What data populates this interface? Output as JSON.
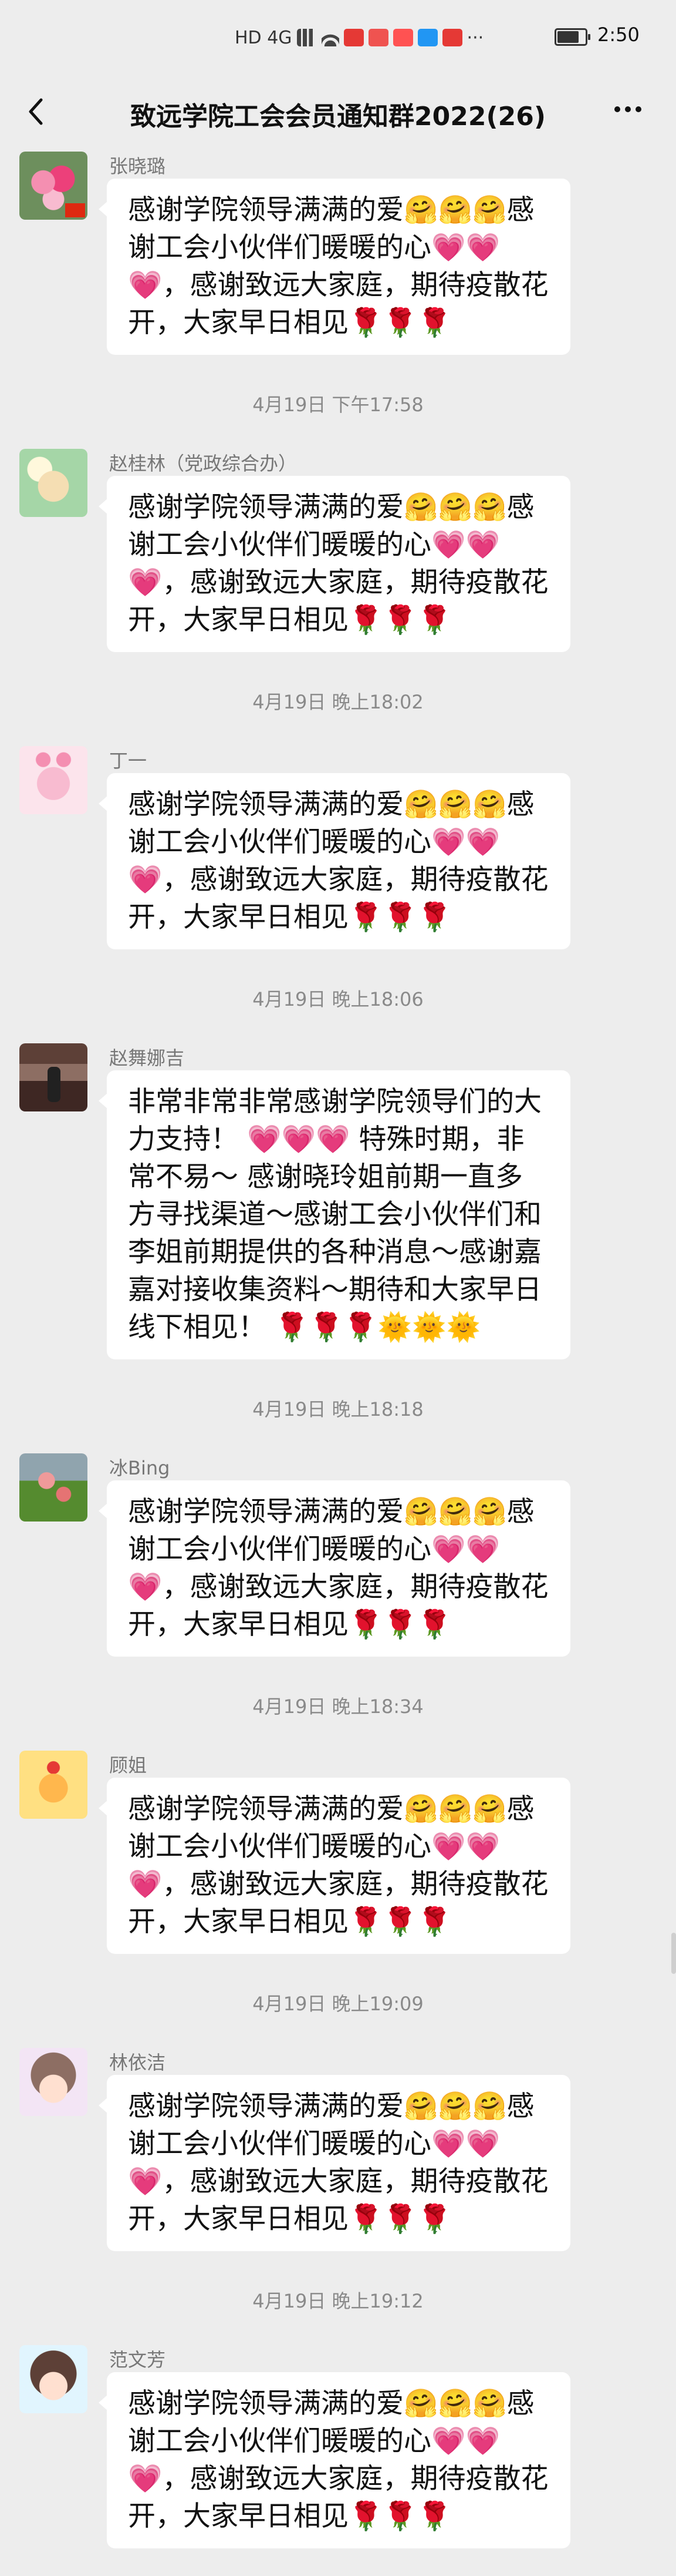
{
  "status_bar": {
    "network": "HD 4G",
    "time": "2:50"
  },
  "header": {
    "title": "致远学院工会会员通知群2022(26)"
  },
  "messages": [
    {
      "sender": "张晓璐",
      "text": "感谢学院领导满满的爱🤗🤗🤗感谢工会小伙伴们暖暖的心💗💗💗，感谢致远大家庭，期待疫散花开，大家早日相见🌹🌹🌹",
      "avatar": "rose-flowers-avatar"
    },
    {
      "timestamp": "4月19日 下午17:58",
      "sender": "赵桂林（党政综合办）",
      "text": "感谢学院领导满满的爱🤗🤗🤗感谢工会小伙伴们暖暖的心💗💗💗，感谢致远大家庭，期待疫散花开，大家早日相见🌹🌹🌹",
      "avatar": "puppy-avatar"
    },
    {
      "timestamp": "4月19日 晚上18:02",
      "sender": "丁一",
      "text": "感谢学院领导满满的爱🤗🤗🤗感谢工会小伙伴们暖暖的心💗💗💗，感谢致远大家庭，期待疫散花开，大家早日相见🌹🌹🌹",
      "avatar": "pink-bunny-avatar"
    },
    {
      "timestamp": "4月19日 晚上18:06",
      "sender": "赵舞娜吉",
      "text": "非常非常非常感谢学院领导们的大力支持！ 💗💗💗 特殊时期，非常不易～ 感谢晓玲姐前期一直多方寻找渠道～感谢工会小伙伴们和李姐前期提供的各种消息～感谢嘉嘉对接收集资料～期待和大家早日线下相见！ 🌹🌹🌹🌞🌞🌞",
      "avatar": "person-photo-avatar"
    },
    {
      "timestamp": "4月19日 晚上18:18",
      "sender": "冰Bing",
      "text": "感谢学院领导满满的爱🤗🤗🤗感谢工会小伙伴们暖暖的心💗💗💗，感谢致远大家庭，期待疫散花开，大家早日相见🌹🌹🌹",
      "avatar": "garden-avatar"
    },
    {
      "timestamp": "4月19日 晚上18:34",
      "sender": "顾姐",
      "text": "感谢学院领导满满的爱🤗🤗🤗感谢工会小伙伴们暖暖的心💗💗💗，感谢致远大家庭，期待疫散花开，大家早日相见🌹🌹🌹",
      "avatar": "cartoon-tiger-avatar"
    },
    {
      "timestamp": "4月19日 晚上19:09",
      "sender": "林依洁",
      "text": "感谢学院领导满满的爱🤗🤗🤗感谢工会小伙伴们暖暖的心💗💗💗，感谢致远大家庭，期待疫散花开，大家早日相见🌹🌹🌹",
      "avatar": "girl-photo-avatar"
    },
    {
      "timestamp": "4月19日 晚上19:12",
      "sender": "范文芳",
      "text": "感谢学院领导满满的爱🤗🤗🤗感谢工会小伙伴们暖暖的心💗💗💗，感谢致远大家庭，期待疫散花开，大家早日相见🌹🌹🌹",
      "avatar": "woman-photo-avatar"
    }
  ]
}
